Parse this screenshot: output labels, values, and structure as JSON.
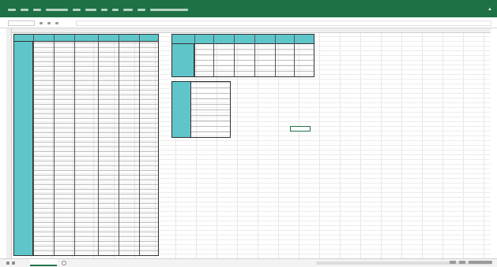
{
  "app": {
    "title": ""
  },
  "ribbon": {
    "tabs": [
      "",
      "",
      "",
      "",
      "",
      "",
      "",
      "",
      "",
      "",
      "",
      ""
    ]
  },
  "formula_bar": {
    "name_box": "",
    "formula": ""
  },
  "sheet": {
    "active_tab": ""
  },
  "colors": {
    "ribbon": "#1e7145",
    "header_fill": "#5fc5c9",
    "selection": "#217346"
  }
}
